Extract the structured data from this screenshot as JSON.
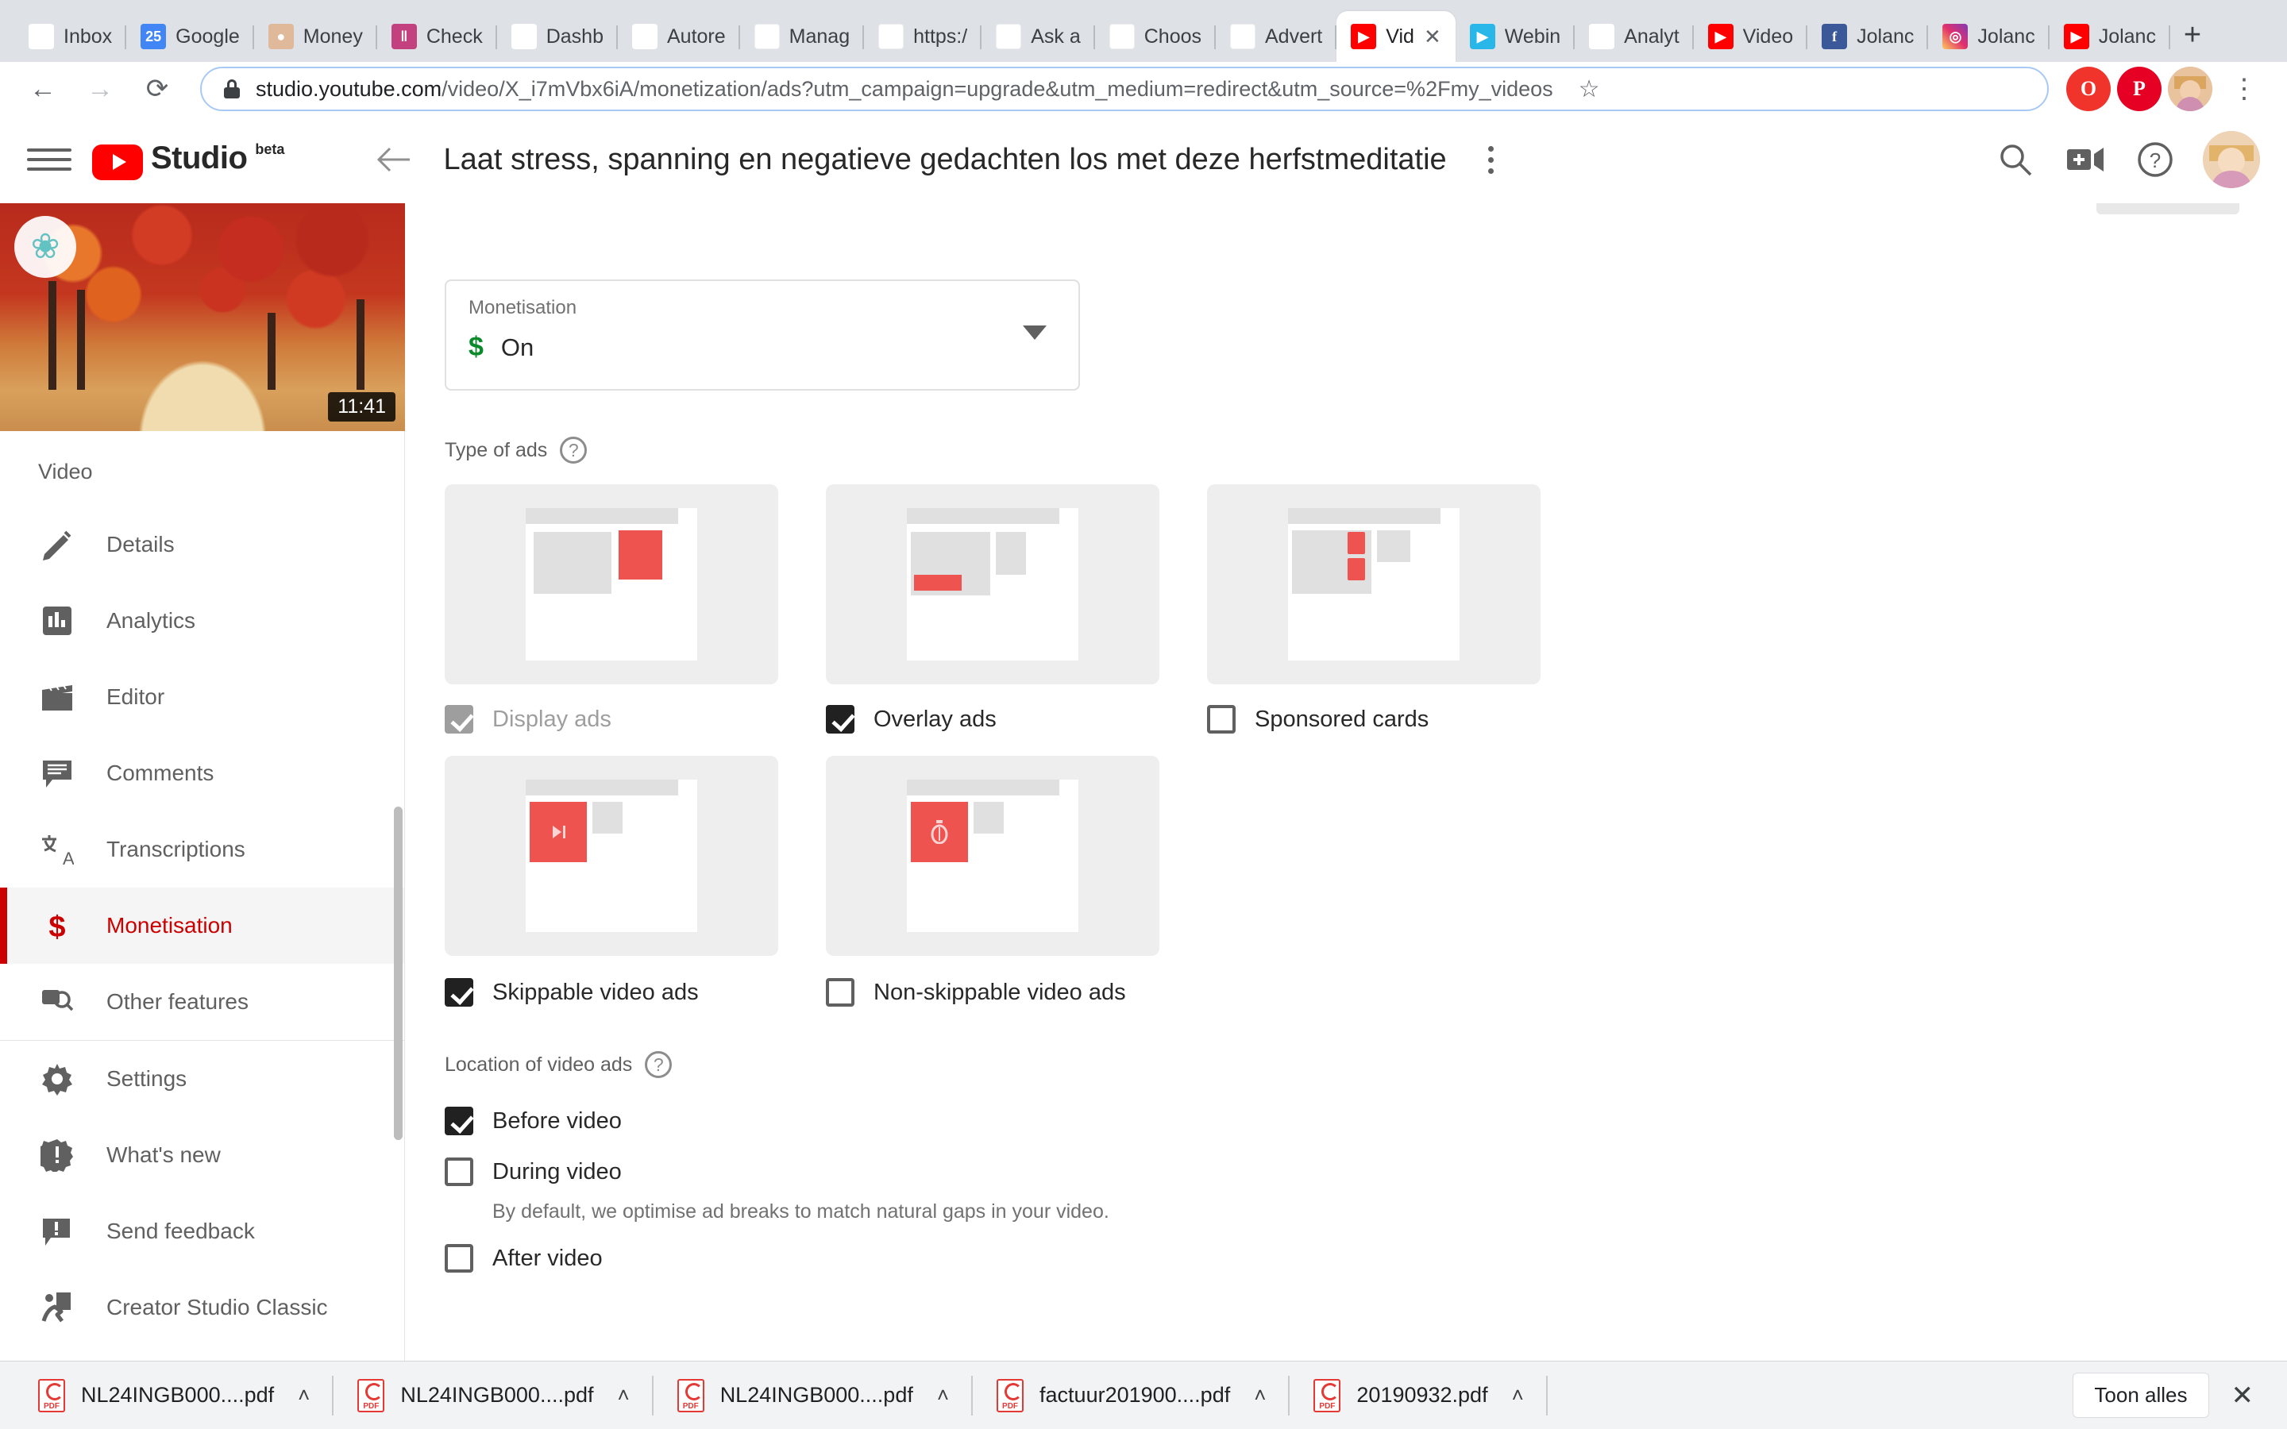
{
  "browser": {
    "tabs": [
      {
        "label": "Inbox",
        "icon": "gmail-icon",
        "glyph": "M",
        "cls": "fi-gmail",
        "active": false
      },
      {
        "label": "Google",
        "icon": "google-calendar-icon",
        "glyph": "25",
        "cls": "fi-cal",
        "active": false
      },
      {
        "label": "Money",
        "icon": "face-icon",
        "glyph": "●",
        "cls": "fi-face",
        "active": false
      },
      {
        "label": "Check",
        "icon": "trello-icon",
        "glyph": "‖",
        "cls": "fi-trello",
        "active": false
      },
      {
        "label": "Dashb",
        "icon": "lotus-icon",
        "glyph": "❀",
        "cls": "fi-lotus",
        "active": false
      },
      {
        "label": "Autore",
        "icon": "autoresponder-icon",
        "glyph": "ℒ",
        "cls": "fi-auto",
        "active": false
      },
      {
        "label": "Manag",
        "icon": "google-icon",
        "glyph": "G",
        "cls": "fi-g",
        "active": false
      },
      {
        "label": "https:/",
        "icon": "google-icon",
        "glyph": "G",
        "cls": "fi-g",
        "active": false
      },
      {
        "label": "Ask a",
        "icon": "google-icon",
        "glyph": "G",
        "cls": "fi-g",
        "active": false
      },
      {
        "label": "Choos",
        "icon": "google-icon",
        "glyph": "G",
        "cls": "fi-g",
        "active": false
      },
      {
        "label": "Advert",
        "icon": "google-icon",
        "glyph": "G",
        "cls": "fi-g",
        "active": false
      },
      {
        "label": "Vid",
        "icon": "youtube-icon",
        "glyph": "▶",
        "cls": "fi-yt",
        "active": true
      },
      {
        "label": "Webin",
        "icon": "webinar-icon",
        "glyph": "▶",
        "cls": "fi-web",
        "active": false
      },
      {
        "label": "Analyt",
        "icon": "google-analytics-icon",
        "glyph": "▂▅█",
        "cls": "fi-ana",
        "active": false
      },
      {
        "label": "Video",
        "icon": "youtube-icon",
        "glyph": "▶",
        "cls": "fi-yt",
        "active": false
      },
      {
        "label": "Jolanc",
        "icon": "facebook-icon",
        "glyph": "f",
        "cls": "fi-fb",
        "active": false
      },
      {
        "label": "Jolanc",
        "icon": "instagram-icon",
        "glyph": "◎",
        "cls": "fi-ig",
        "active": false
      },
      {
        "label": "Jolanc",
        "icon": "youtube-icon",
        "glyph": "▶",
        "cls": "fi-yt",
        "active": false
      }
    ],
    "new_tab_label": "+",
    "tab_close_label": "✕",
    "nav": {
      "back": "←",
      "forward": "→",
      "reload": "⟳"
    },
    "url": {
      "domain": "studio.youtube.com",
      "path": "/video/X_i7mVbx6iA/monetization/ads?utm_campaign=upgrade&utm_medium=redirect&utm_source=%2Fmy_videos",
      "bookmark_star": "☆"
    },
    "toolbar_buttons": [
      {
        "name": "opera-extension-icon",
        "glyph": "O"
      },
      {
        "name": "pinterest-extension-icon",
        "glyph": "P"
      }
    ],
    "profile_menu_glyph": "⋮"
  },
  "studio": {
    "logo_word": "Studio",
    "logo_beta": "beta",
    "video_title": "Laat stress, spanning en negatieve gedachten los met deze herfstmeditatie",
    "header_icons": [
      {
        "name": "search-icon"
      },
      {
        "name": "create-video-icon"
      },
      {
        "name": "help-icon"
      }
    ],
    "sidebar": {
      "section_title": "Video",
      "thumbnail_duration": "11:41",
      "items": [
        {
          "label": "Details",
          "icon": "pencil-icon",
          "active": false
        },
        {
          "label": "Analytics",
          "icon": "bar-chart-icon",
          "active": false
        },
        {
          "label": "Editor",
          "icon": "clapperboard-icon",
          "active": false
        },
        {
          "label": "Comments",
          "icon": "comment-icon",
          "active": false
        },
        {
          "label": "Transcriptions",
          "icon": "translate-icon",
          "active": false
        },
        {
          "label": "Monetisation",
          "icon": "dollar-icon",
          "active": true
        },
        {
          "label": "Other features",
          "icon": "other-features-icon",
          "active": false
        }
      ],
      "footer_items": [
        {
          "label": "Settings",
          "icon": "gear-icon"
        },
        {
          "label": "What's new",
          "icon": "whats-new-icon"
        },
        {
          "label": "Send feedback",
          "icon": "feedback-icon"
        },
        {
          "label": "Creator Studio Classic",
          "icon": "exit-door-icon"
        }
      ]
    },
    "monetisation_field": {
      "label": "Monetisation",
      "value": "On",
      "currency_glyph": "$",
      "accent_color": "#0b8a2b"
    },
    "type_of_ads": {
      "heading": "Type of ads",
      "help_glyph": "?",
      "options": [
        {
          "label": "Display ads",
          "checked": true,
          "disabled": true
        },
        {
          "label": "Overlay ads",
          "checked": true,
          "disabled": false
        },
        {
          "label": "Sponsored cards",
          "checked": false,
          "disabled": false
        },
        {
          "label": "Skippable video ads",
          "checked": true,
          "disabled": false
        },
        {
          "label": "Non-skippable video ads",
          "checked": false,
          "disabled": false
        }
      ]
    },
    "location_of_video_ads": {
      "heading": "Location of video ads",
      "help_glyph": "?",
      "options": [
        {
          "label": "Before video",
          "checked": true
        },
        {
          "label": "During video",
          "checked": false
        },
        {
          "label": "After video",
          "checked": false
        }
      ],
      "hint": "By default, we optimise ad breaks to match natural gaps in your video."
    },
    "accent_red": "#cc0000",
    "ad_preview_red": "#ee5350"
  },
  "downloads": {
    "items": [
      {
        "name": "NL24INGB000....pdf"
      },
      {
        "name": "NL24INGB000....pdf"
      },
      {
        "name": "NL24INGB000....pdf"
      },
      {
        "name": "factuur201900....pdf"
      },
      {
        "name": "20190932.pdf"
      }
    ],
    "caret_glyph": "˄",
    "show_all_label": "Toon alles",
    "close_glyph": "✕"
  }
}
